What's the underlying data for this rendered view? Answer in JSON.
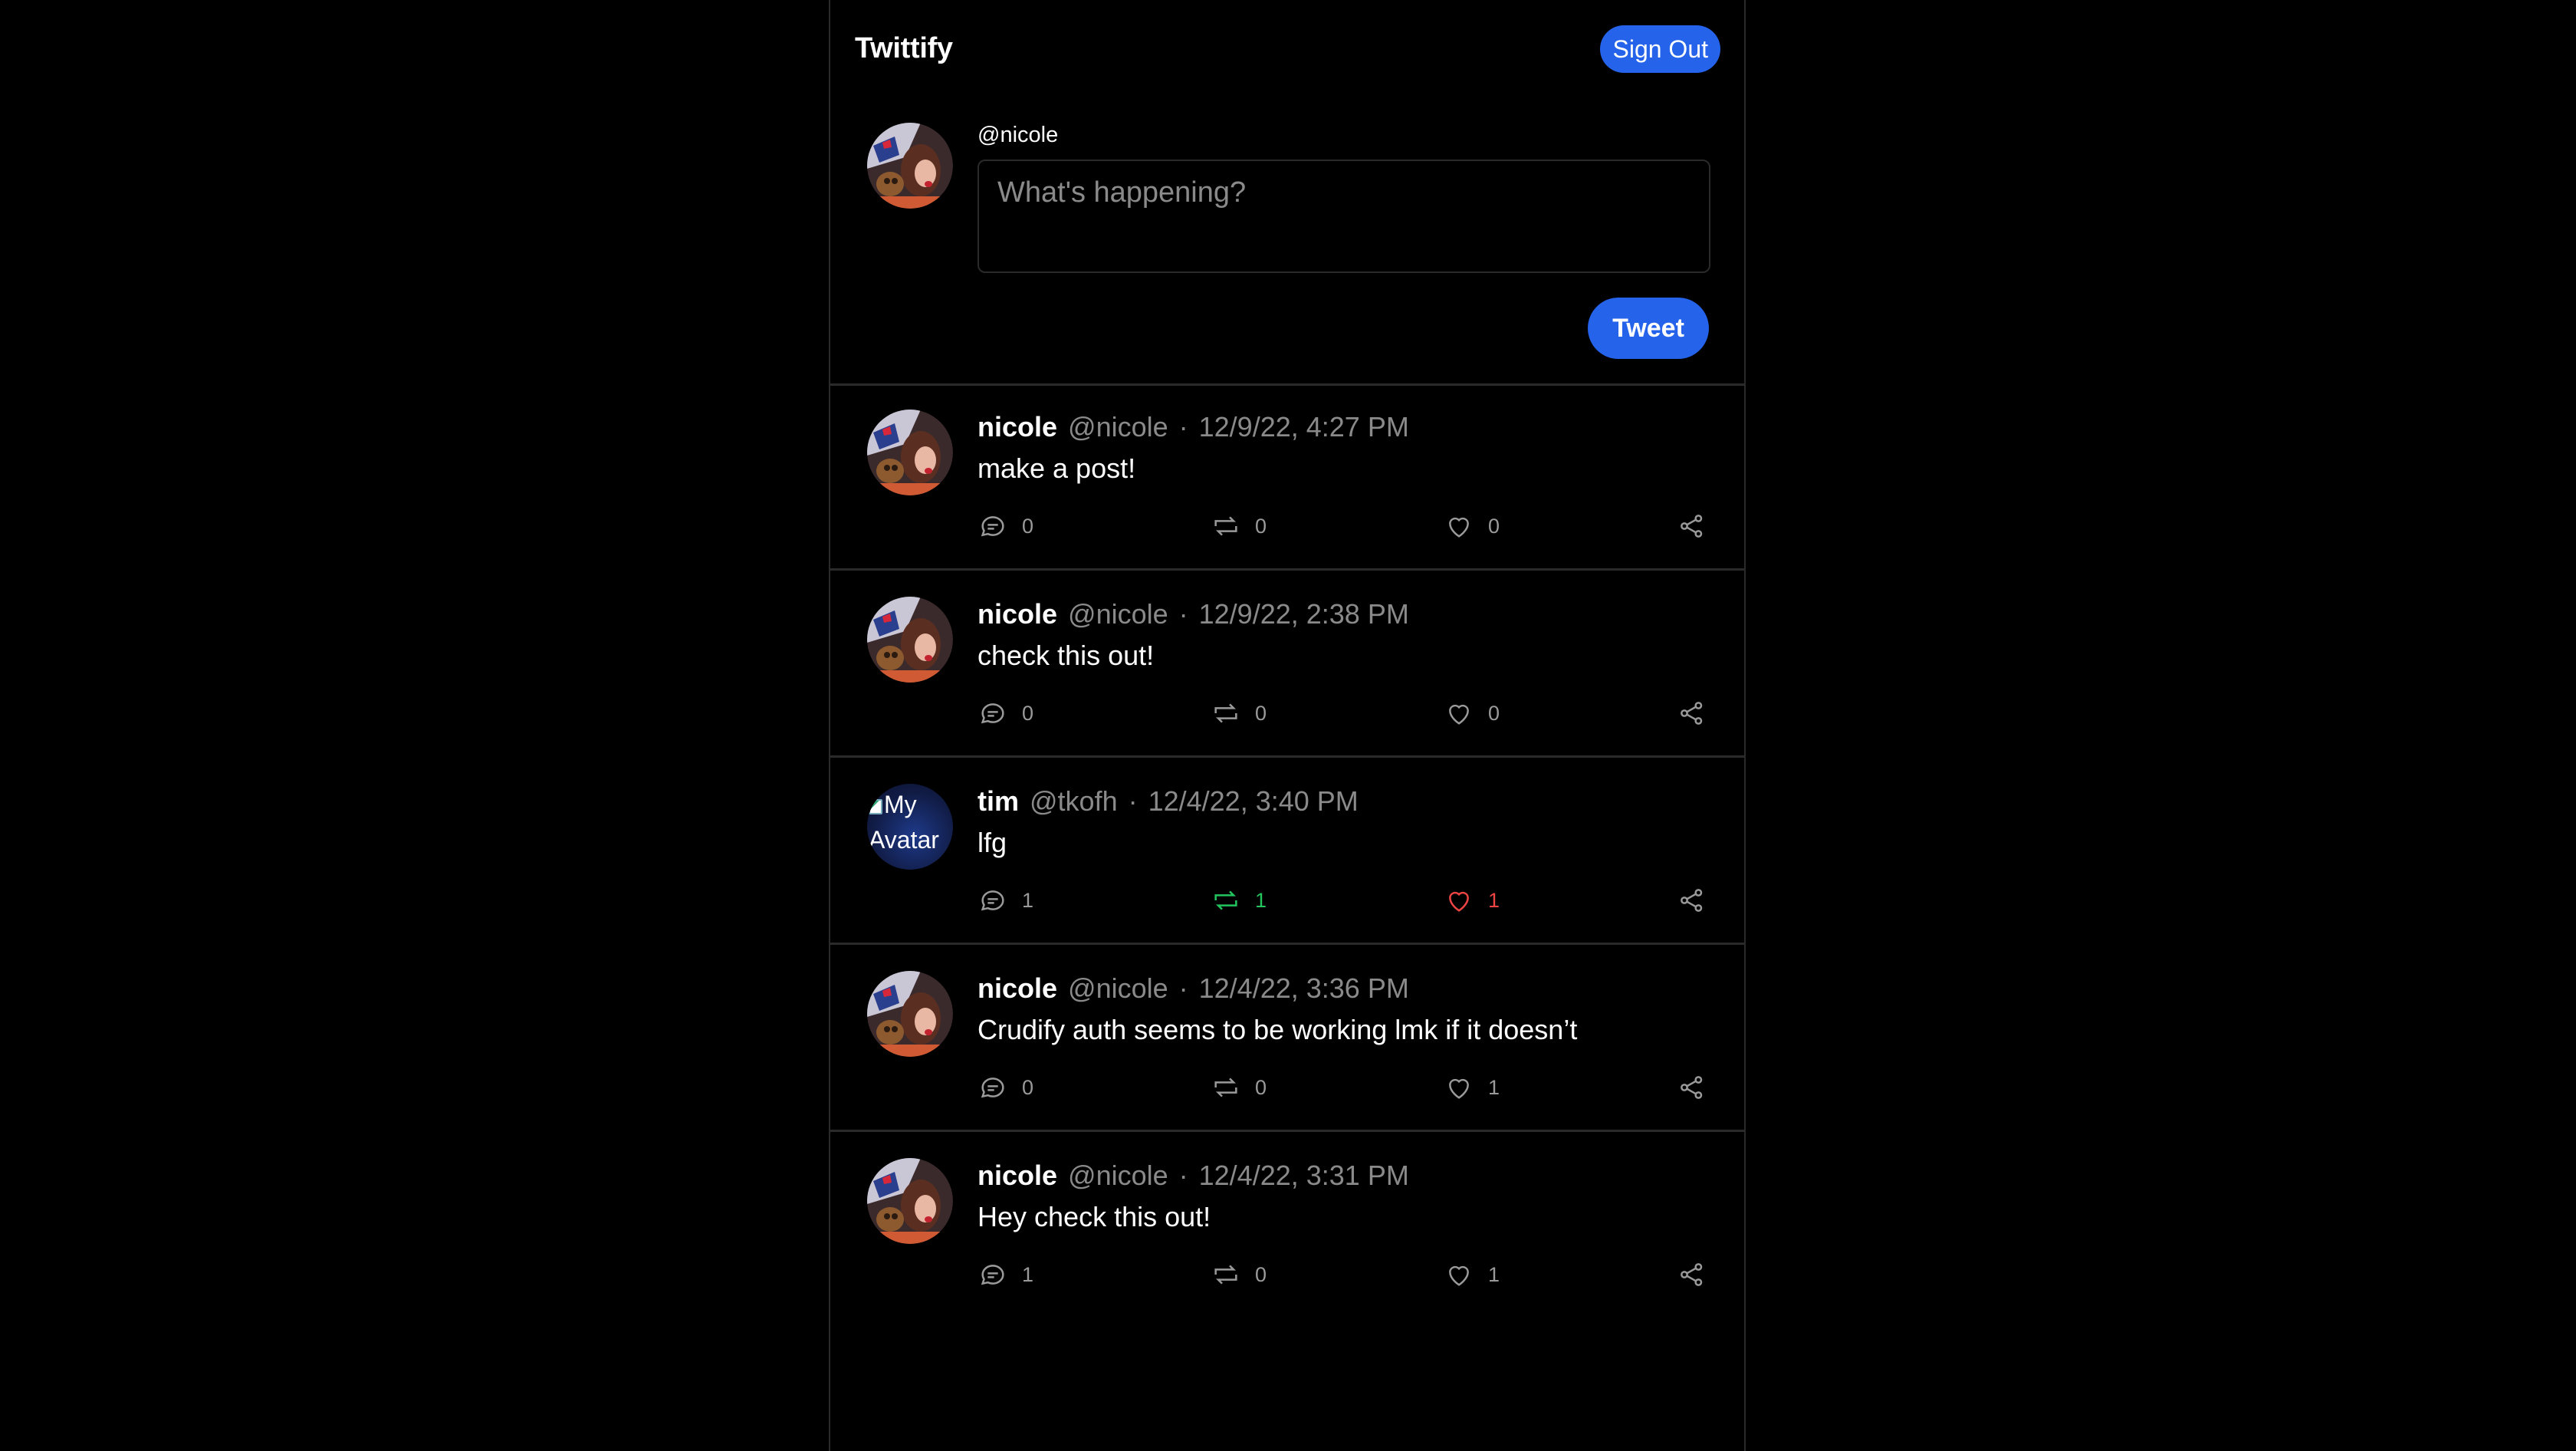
{
  "app": {
    "title": "Twittify",
    "sign_out_label": "Sign Out"
  },
  "composer": {
    "handle": "@nicole",
    "placeholder": "What's happening?",
    "value": "",
    "submit_label": "Tweet"
  },
  "colors": {
    "accent": "#2563eb",
    "retweet_active": "#22c55e",
    "like_active": "#ef4444",
    "muted": "#8a8a8a"
  },
  "tweets": [
    {
      "name": "nicole",
      "handle": "@nicole",
      "separator": "·",
      "timestamp": "12/9/22, 4:27 PM",
      "text": "make a post!",
      "replies": "0",
      "retweets": "0",
      "likes": "0",
      "retweeted": false,
      "liked": false
    },
    {
      "name": "nicole",
      "handle": "@nicole",
      "separator": "·",
      "timestamp": "12/9/22, 2:38 PM",
      "text": "check this out!",
      "replies": "0",
      "retweets": "0",
      "likes": "0",
      "retweeted": false,
      "liked": false
    },
    {
      "name": "tim",
      "handle": "@tkofh",
      "separator": "·",
      "timestamp": "12/4/22, 3:40 PM",
      "text": "lfg",
      "replies": "1",
      "retweets": "1",
      "likes": "1",
      "retweeted": true,
      "liked": true,
      "avatar_alt": "My Avatar"
    },
    {
      "name": "nicole",
      "handle": "@nicole",
      "separator": "·",
      "timestamp": "12/4/22, 3:36 PM",
      "text": "Crudify auth seems to be working lmk if it doesn’t",
      "replies": "0",
      "retweets": "0",
      "likes": "1",
      "retweeted": false,
      "liked": false
    },
    {
      "name": "nicole",
      "handle": "@nicole",
      "separator": "·",
      "timestamp": "12/4/22, 3:31 PM",
      "text": "Hey check this out!",
      "replies": "1",
      "retweets": "0",
      "likes": "1",
      "retweeted": false,
      "liked": false
    }
  ]
}
